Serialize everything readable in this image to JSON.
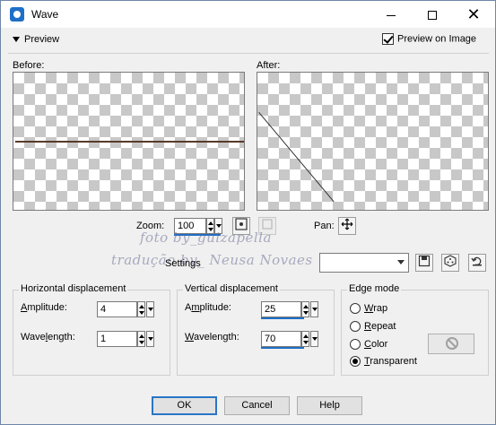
{
  "window": {
    "title": "Wave",
    "icon": "paint-shop-pro-icon"
  },
  "preview": {
    "toggle_label": "Preview",
    "preview_on_image_label": "Preview on Image",
    "preview_on_image_checked": true,
    "before_label": "Before:",
    "after_label": "After:"
  },
  "zoom": {
    "label": "Zoom:",
    "value": "100"
  },
  "pan": {
    "label": "Pan:",
    "icon": "move-cross-icon"
  },
  "settings": {
    "label": "Settings",
    "value": ""
  },
  "watermark": {
    "line1": "foto by_guizapella",
    "line2": "tradução by_ Neusa Novaes"
  },
  "horizontal": {
    "title": "Horizontal displacement",
    "amplitude_label": "Amplitude:",
    "amplitude_value": "4",
    "wavelength_label": "Wavelength:",
    "wavelength_value": "1"
  },
  "vertical": {
    "title": "Vertical displacement",
    "amplitude_label": "Amplitude:",
    "amplitude_value": "25",
    "wavelength_label": "Wavelength:",
    "wavelength_value": "70"
  },
  "edge_mode": {
    "title": "Edge mode",
    "options": [
      "Wrap",
      "Repeat",
      "Color",
      "Transparent"
    ],
    "selected": "Transparent"
  },
  "buttons": {
    "ok": "OK",
    "cancel": "Cancel",
    "help": "Help"
  },
  "colors": {
    "accent": "#1e6fc7",
    "default_button_border": "#2b75c6",
    "dialog_bg": "#f0f0f0"
  }
}
